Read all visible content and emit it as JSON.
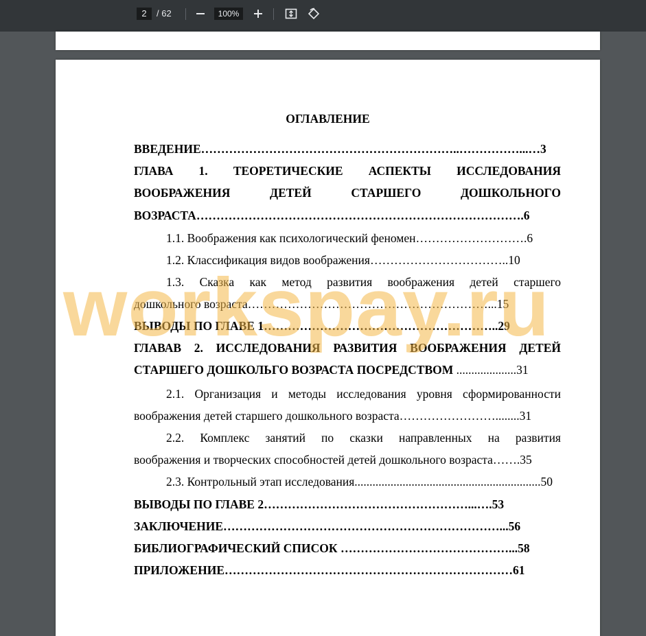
{
  "toolbar": {
    "page_current": "2",
    "page_total": "/ 62",
    "zoom_minus": "−",
    "zoom_level": "100%",
    "zoom_plus": "+",
    "fit_icon": "fit-page-icon",
    "rotate_icon": "rotate-icon"
  },
  "document": {
    "title": "ОГЛАВЛЕНИЕ",
    "watermark": "workspay.ru",
    "lines": {
      "l1": "ВВЕДЕНИЕ………………………………………………………..……………...…3",
      "l2": "ГЛАВА 1. ТЕОРЕТИЧЕСКИЕ АСПЕКТЫ ИССЛЕДОВАНИЯ",
      "l3": "ВООБРАЖЕНИЯ ДЕТЕЙ СТАРШЕГО ДОШКОЛЬНОГО",
      "l4": "ВОЗРАСТА……………………………………………………………………….6",
      "l5": "1.1. Воображения как психологический феномен……………………….6",
      "l6": "1.2. Классификация видов воображения……………………………..10",
      "l7": "1.3. Сказка как метод развития воображения детей старшего",
      "l8": "дошкольного возраста……………………………………………………...15",
      "l9": "ВЫВОДЫ ПО ГЛАВЕ 1…………………………………………………..29",
      "l10": "ГЛАВАВ 2. ИССЛЕДОВАНИЯ РАЗВИТИЯ ВООБРАЖЕНИЯ ДЕТЕЙ",
      "l11a": "СТАРШЕГО ДОШКОЛЬГО ВОЗРАСТА ПОСРЕДСТВОМ",
      "l11b": " ....................31",
      "l12": "2.1. Организация и методы исследования уровня сформированности",
      "l13": "воображения детей старшего дошкольного возраста……………………........31",
      "l14": "2.2. Комплекс занятий по сказки направленных на развития",
      "l15": "воображения и творческих способностей детей дошкольного возраста…….35",
      "l16": "2.3. Контрольный этап исследования..............................................................50",
      "l17": "ВЫВОДЫ ПО ГЛАВЕ 2……………………………………………...….53",
      "l18": "ЗАКЛЮЧЕНИЕ……………………………………………………………...56",
      "l19": "БИБЛИОГРАФИЧЕСКИЙ СПИСОК ……………………………………...58",
      "l20": "ПРИЛОЖЕНИЕ………………………………………………………………61"
    }
  }
}
